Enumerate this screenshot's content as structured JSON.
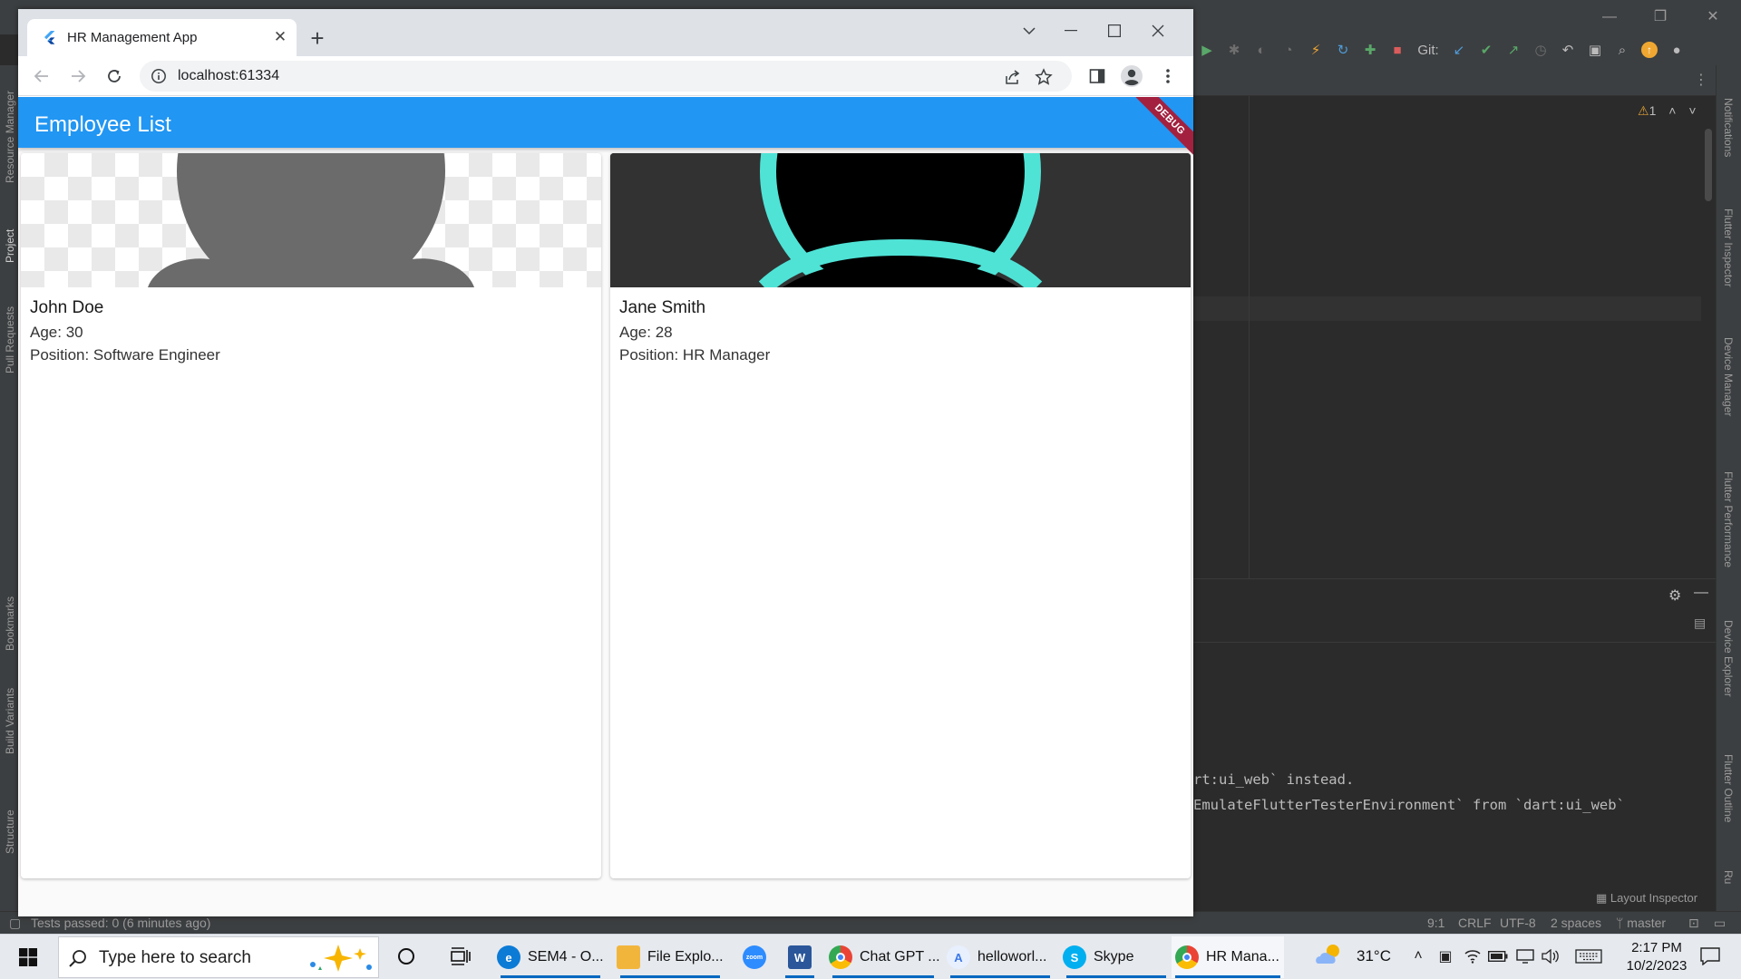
{
  "browser": {
    "tab_title": "HR Management App",
    "tab_close": "✕",
    "new_tab": "+",
    "url": "localhost:61334"
  },
  "app": {
    "title": "Employee List",
    "debug_banner": "DEBUG",
    "employees": [
      {
        "name": "John Doe",
        "age": "Age: 30",
        "position": "Position: Software Engineer"
      },
      {
        "name": "Jane Smith",
        "age": "Age: 28",
        "position": "Position: HR Manager"
      }
    ]
  },
  "ide": {
    "git_label": "Git:",
    "warning_count": "1",
    "console_lines": [
      "rt:ui_web` instead.",
      "EmulateFlutterTesterEnvironment` from `dart:ui_web`"
    ],
    "right_tools": [
      "Notifications",
      "Flutter Inspector",
      "Device Manager",
      "Flutter Performance",
      "Device Explorer",
      "Flutter Outline",
      "Ru"
    ],
    "left_tools": [
      "Resource Manager",
      "Project",
      "Pull Requests",
      "Bookmarks",
      "Build Variants",
      "Structure"
    ],
    "layout_inspector": "Layout Inspector",
    "status_left": "Tests passed: 0 (6 minutes ago)",
    "status_position": "9:1",
    "status_line_sep": "CRLF",
    "status_encoding": "UTF-8",
    "status_indent": "2 spaces",
    "status_branch": "master"
  },
  "taskbar": {
    "search_placeholder": "Type here to search",
    "apps": [
      {
        "label": "SEM4 - O...",
        "color": "#0c7bd6"
      },
      {
        "label": "File Explo...",
        "color": "#f2b53c"
      },
      {
        "label": "",
        "color": "#2d8cff"
      },
      {
        "label": "",
        "color": "#2b579a"
      },
      {
        "label": "Chat GPT ...",
        "color": "#ea4335"
      },
      {
        "label": "helloworl...",
        "color": "#3b78e7"
      },
      {
        "label": "Skype",
        "color": "#00aff0"
      },
      {
        "label": "HR Mana...",
        "color": "#ea4335"
      }
    ],
    "zoom_label": "zoom",
    "word_label": "W",
    "skype_letter": "S",
    "temperature": "31°C",
    "time": "2:17 PM",
    "date": "10/2/2023"
  },
  "colors": {
    "appbar": "#2196f3",
    "debug": "#a3213f",
    "avatar_gray": "#6b6b6b",
    "avatar_teal": "#4fe3d6"
  }
}
